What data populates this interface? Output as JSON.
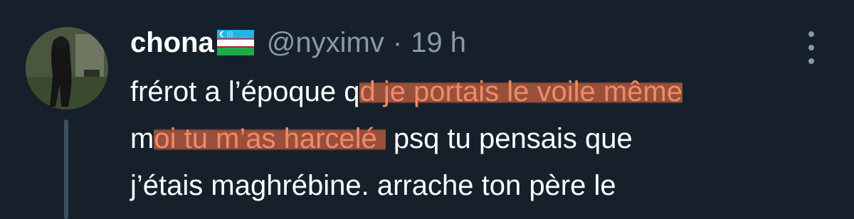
{
  "tweet": {
    "author_name": "chona",
    "author_flag": "uzbekistan-flag-icon",
    "handle": "@nyximv",
    "separator": "·",
    "time": "19 h",
    "lines": [
      {
        "before": "frérot a l’époque q",
        "highlight": "d je portais le voile même",
        "after": ""
      },
      {
        "before": "m",
        "highlight": "oi tu m’as harcelé",
        "after": " psq tu pensais que"
      },
      {
        "before": "j’étais maghrébine. arrache ton père le",
        "highlight": "",
        "after": ""
      }
    ]
  },
  "colors": {
    "background": "#15202b",
    "text": "#ffffff",
    "muted": "#8b98a5",
    "highlight_mark": "#b0583c",
    "highlight_text": "#ef8a6a"
  }
}
